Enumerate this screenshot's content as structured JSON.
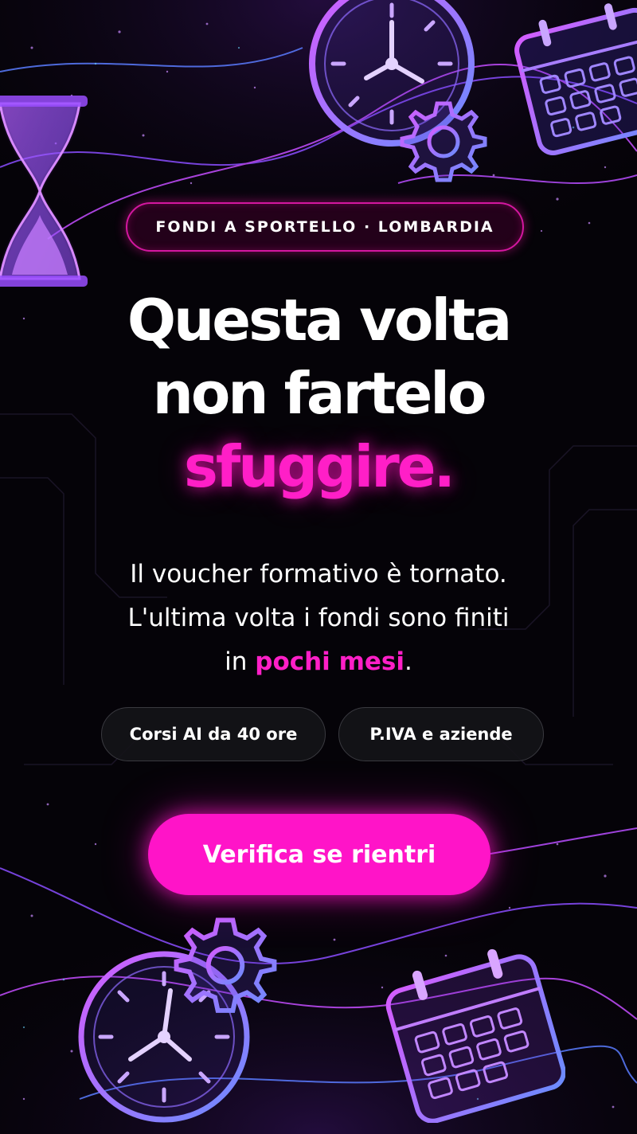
{
  "colors": {
    "background": "#050308",
    "accent": "#ff1fc7",
    "button": "#ff14c8",
    "neon_purple": "#b35cff",
    "neon_blue": "#5c8cff"
  },
  "badge": {
    "label": "FONDI A SPORTELLO · LOMBARDIA"
  },
  "headline": {
    "line1": "Questa volta",
    "line2": "non fartelo",
    "accent": "sfuggire."
  },
  "body": {
    "line1": "Il voucher formativo è tornato.",
    "line2": "L'ultima volta i fondi sono finiti",
    "line3_prefix": "in ",
    "line3_highlight": "pochi mesi",
    "line3_suffix": "."
  },
  "pills": [
    {
      "label": "Corsi AI da 40 ore"
    },
    {
      "label": "P.IVA e aziende"
    }
  ],
  "cta": {
    "label": "Verifica se rientri"
  },
  "decorations": {
    "icons": [
      "hourglass-icon",
      "clock-icon",
      "gear-icon",
      "calendar-icon"
    ]
  }
}
